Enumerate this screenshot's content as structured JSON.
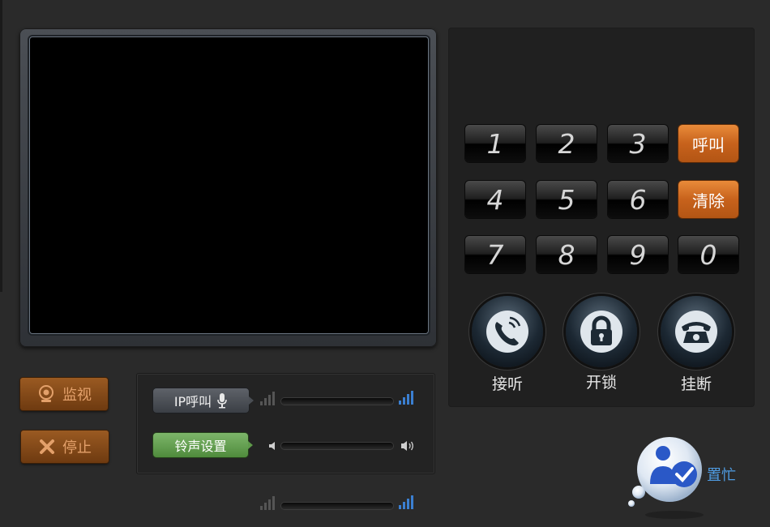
{
  "video": {},
  "keypad": {
    "keys": [
      "1",
      "2",
      "3",
      "4",
      "5",
      "6",
      "7",
      "8",
      "9",
      "0"
    ],
    "call_label": "呼叫",
    "clear_label": "清除"
  },
  "actions": {
    "answer_label": "接听",
    "unlock_label": "开锁",
    "hangup_label": "挂断"
  },
  "side": {
    "monitor_label": "监视",
    "stop_label": "停止"
  },
  "audio": {
    "ip_call_label": "IP呼叫",
    "ringtone_label": "铃声设置"
  },
  "status": {
    "busy_label": "置忙"
  },
  "colors": {
    "accent_orange": "#c7621c",
    "accent_green": "#5e9a4a",
    "busy_blue": "#4f9de4"
  }
}
